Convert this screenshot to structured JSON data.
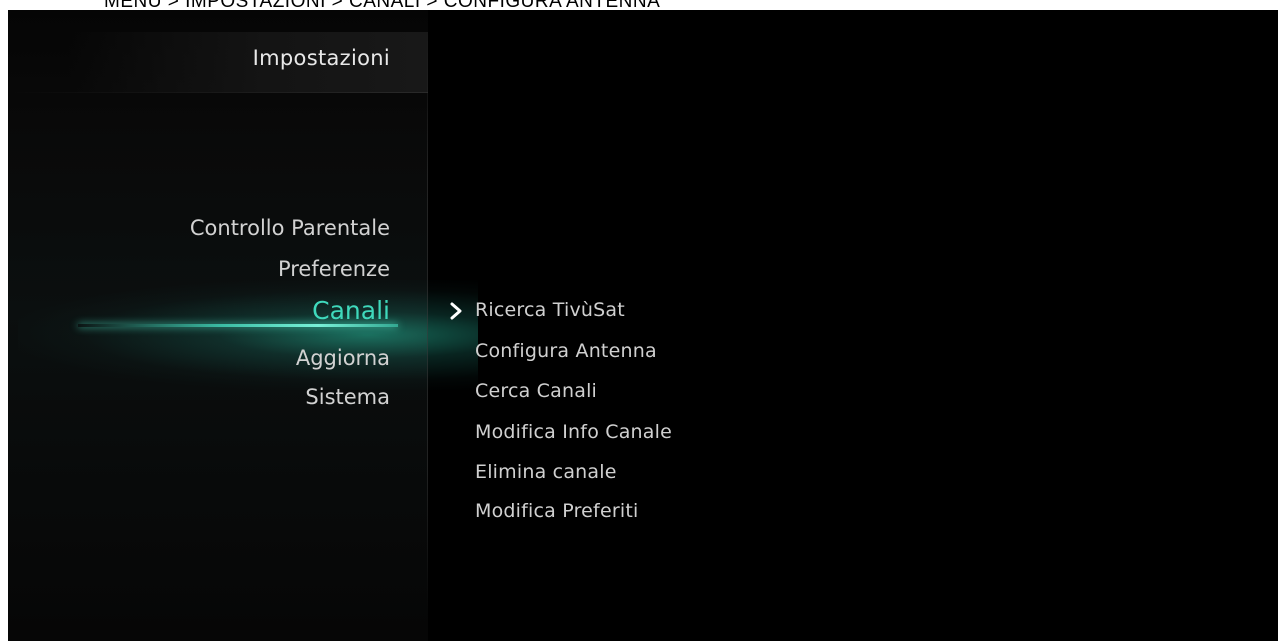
{
  "breadcrumb": "MENU > IMPOSTAZIONI > CANALI > CONFIGURA ANTENNA",
  "sidebar": {
    "title": "Impostazioni",
    "items": [
      {
        "label": "Controllo Parentale",
        "active": false
      },
      {
        "label": "Preferenze",
        "active": false
      },
      {
        "label": "Canali",
        "active": true
      },
      {
        "label": "Aggiorna",
        "active": false
      },
      {
        "label": "Sistema",
        "active": false
      }
    ]
  },
  "submenu": {
    "items": [
      {
        "label": "Ricerca TivùSat",
        "selected": true
      },
      {
        "label": "Configura Antenna",
        "selected": false
      },
      {
        "label": "Cerca Canali",
        "selected": false
      },
      {
        "label": "Modifica Info Canale",
        "selected": false
      },
      {
        "label": "Elimina canale",
        "selected": false
      },
      {
        "label": "Modifica Preferiti",
        "selected": false
      }
    ]
  },
  "colors": {
    "accent": "#3fd9bc",
    "background": "#000000",
    "text": "#d0d0d0"
  },
  "icons": {
    "selector": "chevron-right-icon"
  }
}
